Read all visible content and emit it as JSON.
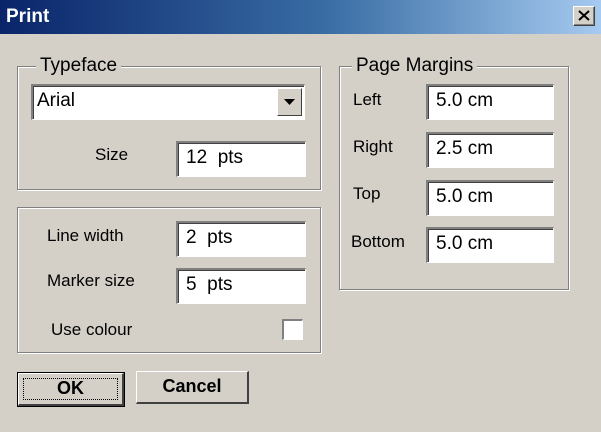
{
  "window": {
    "title": "Print"
  },
  "typeface": {
    "legend": "Typeface",
    "font_value": "Arial",
    "size_label": "Size",
    "size_value": "12  pts"
  },
  "lines": {
    "line_width_label": "Line width",
    "line_width_value": "2  pts",
    "marker_size_label": "Marker size",
    "marker_size_value": "5  pts",
    "use_colour_label": "Use colour",
    "use_colour_checked": false
  },
  "margins": {
    "legend": "Page Margins",
    "left_label": "Left",
    "left_value": "5.0 cm",
    "right_label": "Right",
    "right_value": "2.5 cm",
    "top_label": "Top",
    "top_value": "5.0 cm",
    "bottom_label": "Bottom",
    "bottom_value": "5.0 cm"
  },
  "buttons": {
    "ok_label": "OK",
    "cancel_label": "Cancel"
  },
  "icons": {
    "close": "close-icon",
    "dropdown": "chevron-down-icon"
  },
  "colors": {
    "titlebar_start": "#0a246a",
    "titlebar_end": "#a6caf0",
    "face": "#d4d0c8"
  }
}
